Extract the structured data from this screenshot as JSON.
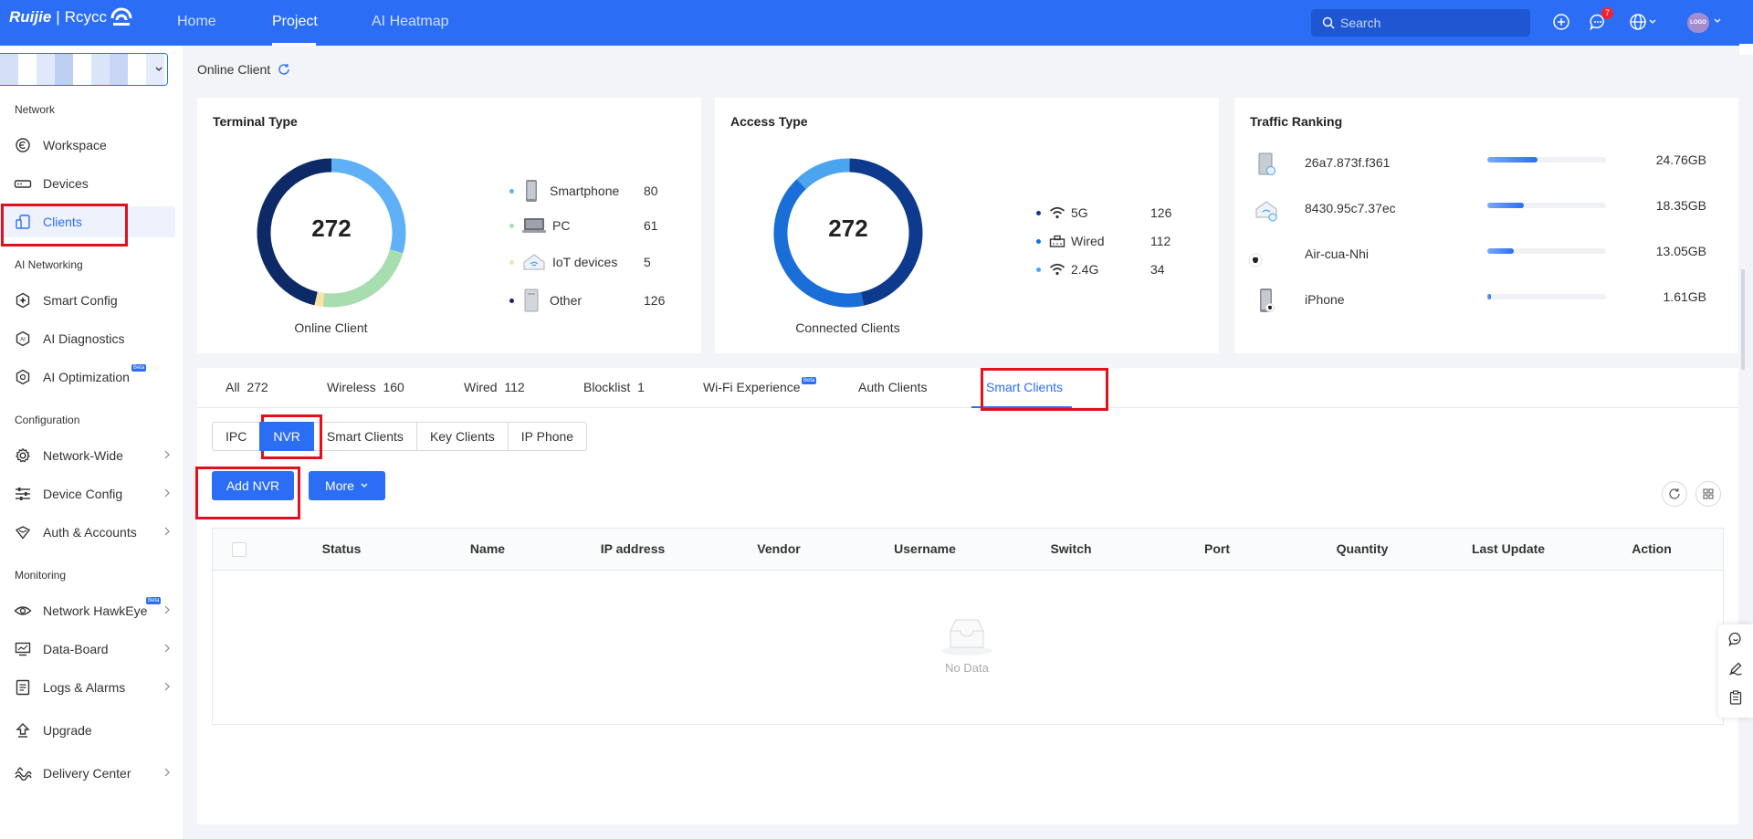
{
  "topnav": {
    "brand": "Ruijie",
    "brand_sub": "Rcycc",
    "links": [
      "Home",
      "Project",
      "AI Heatmap"
    ],
    "active": "Project",
    "search_placeholder": "Search",
    "notification_count": "7",
    "avatar_text": "LOGO"
  },
  "sidebar": {
    "sections": {
      "network": "Network",
      "ai_networking": "AI Networking",
      "configuration": "Configuration",
      "monitoring": "Monitoring"
    },
    "items": [
      {
        "label": "Workspace",
        "icon": "workspace-icon"
      },
      {
        "label": "Devices",
        "icon": "devices-icon"
      },
      {
        "label": "Clients",
        "icon": "clients-icon",
        "active": true
      },
      {
        "label": "Smart Config",
        "icon": "smart-config-icon"
      },
      {
        "label": "AI Diagnostics",
        "icon": "ai-diagnostics-icon"
      },
      {
        "label": "AI Optimization",
        "icon": "ai-optimization-icon",
        "badge": "Beta"
      },
      {
        "label": "Network-Wide",
        "icon": "gear-icon"
      },
      {
        "label": "Device Config",
        "icon": "sliders-icon"
      },
      {
        "label": "Auth & Accounts",
        "icon": "auth-icon"
      },
      {
        "label": "Network HawkEye",
        "icon": "eye-icon",
        "badge": "Beta"
      },
      {
        "label": "Data-Board",
        "icon": "dashboard-icon"
      },
      {
        "label": "Logs & Alarms",
        "icon": "logs-icon"
      },
      {
        "label": "Upgrade",
        "icon": "upgrade-icon"
      },
      {
        "label": "Delivery Center",
        "icon": "delivery-icon"
      }
    ]
  },
  "page": {
    "title": "Online Client"
  },
  "terminal_type": {
    "title": "Terminal Type",
    "total": "272",
    "caption": "Online Client",
    "legend": [
      {
        "label": "Smartphone",
        "value": "80",
        "color": "#5fb0f6"
      },
      {
        "label": "PC",
        "value": "61",
        "color": "#a8ddb0"
      },
      {
        "label": "IoT devices",
        "value": "5",
        "color": "#f8e2a6"
      },
      {
        "label": "Other",
        "value": "126",
        "color": "#0e2a66"
      }
    ]
  },
  "access_type": {
    "title": "Access Type",
    "total": "272",
    "caption": "Connected Clients",
    "legend": [
      {
        "label": "5G",
        "value": "126",
        "color": "#0d3a8c"
      },
      {
        "label": "Wired",
        "value": "112",
        "color": "#1a6ed8"
      },
      {
        "label": "2.4G",
        "value": "34",
        "color": "#4aa4ee"
      }
    ]
  },
  "traffic_ranking": {
    "title": "Traffic Ranking",
    "rows": [
      {
        "name": "26a7.873f.f361",
        "value": "24.76GB",
        "fraction": 0.42
      },
      {
        "name": "8430.95c7.37ec",
        "value": "18.35GB",
        "fraction": 0.31
      },
      {
        "name": "Air-cua-Nhi",
        "value": "13.05GB",
        "fraction": 0.22
      },
      {
        "name": "iPhone",
        "value": "1.61GB",
        "fraction": 0.03
      }
    ]
  },
  "tabs": {
    "items": [
      {
        "label": "All",
        "count": "272"
      },
      {
        "label": "Wireless",
        "count": "160"
      },
      {
        "label": "Wired",
        "count": "112"
      },
      {
        "label": "Blocklist",
        "count": "1"
      },
      {
        "label": "Wi-Fi Experience",
        "count": "",
        "badge": "Beta"
      },
      {
        "label": "Auth Clients",
        "count": ""
      },
      {
        "label": "Smart Clients",
        "count": "",
        "active": true
      }
    ]
  },
  "subtabs": {
    "items": [
      "IPC",
      "NVR",
      "Smart Clients",
      "Key Clients",
      "IP Phone"
    ],
    "active": "NVR"
  },
  "toolbar": {
    "add_label": "Add NVR",
    "more_label": "More"
  },
  "table": {
    "columns": [
      "Status",
      "Name",
      "IP address",
      "Vendor",
      "Username",
      "Switch",
      "Port",
      "Quantity",
      "Last Update",
      "Action"
    ],
    "empty_text": "No Data"
  },
  "colors": {
    "accent": "#2b6ef5",
    "highlight_box": "#e0101e"
  }
}
